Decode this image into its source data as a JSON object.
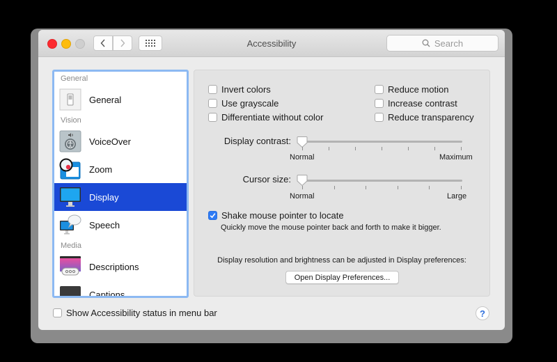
{
  "window": {
    "title": "Accessibility",
    "search_placeholder": "Search",
    "icons": {
      "close": "close-traffic-light",
      "minimize": "minimize-traffic-light",
      "maximize": "zoom-traffic-light",
      "back": "chevron-left",
      "forward": "chevron-right",
      "show_all": "grid"
    }
  },
  "sidebar": {
    "items": [
      {
        "type": "section",
        "label": "General"
      },
      {
        "type": "item",
        "label": "General",
        "icon": "general-switch-icon",
        "selected": false
      },
      {
        "type": "section",
        "label": "Vision"
      },
      {
        "type": "item",
        "label": "VoiceOver",
        "icon": "voiceover-icon",
        "selected": false
      },
      {
        "type": "item",
        "label": "Zoom",
        "icon": "zoom-magnifier-icon",
        "selected": false
      },
      {
        "type": "item",
        "label": "Display",
        "icon": "display-monitor-icon",
        "selected": true
      },
      {
        "type": "item",
        "label": "Speech",
        "icon": "speech-bubble-icon",
        "selected": false
      },
      {
        "type": "section",
        "label": "Media"
      },
      {
        "type": "item",
        "label": "Descriptions",
        "icon": "descriptions-icon",
        "selected": false
      },
      {
        "type": "item",
        "label": "Captions",
        "icon": "captions-icon",
        "selected": false
      }
    ]
  },
  "display_pane": {
    "checkboxes_left": [
      {
        "label": "Invert colors",
        "checked": false
      },
      {
        "label": "Use grayscale",
        "checked": false
      },
      {
        "label": "Differentiate without color",
        "checked": false
      }
    ],
    "checkboxes_right": [
      {
        "label": "Reduce motion",
        "checked": false
      },
      {
        "label": "Increase contrast",
        "checked": false
      },
      {
        "label": "Reduce transparency",
        "checked": false
      }
    ],
    "display_contrast": {
      "label": "Display contrast:",
      "min_label": "Normal",
      "max_label": "Maximum",
      "value_fraction": 0
    },
    "cursor_size": {
      "label": "Cursor size:",
      "min_label": "Normal",
      "max_label": "Large",
      "value_fraction": 0
    },
    "shake": {
      "label": "Shake mouse pointer to locate",
      "checked": true,
      "description": "Quickly move the mouse pointer back and forth to make it bigger."
    },
    "resolution_note": "Display resolution and brightness can be adjusted in Display preferences:",
    "open_prefs_button": "Open Display Preferences..."
  },
  "footer": {
    "status_checkbox": {
      "label": "Show Accessibility status in menu bar",
      "checked": false
    },
    "help_label": "?"
  }
}
